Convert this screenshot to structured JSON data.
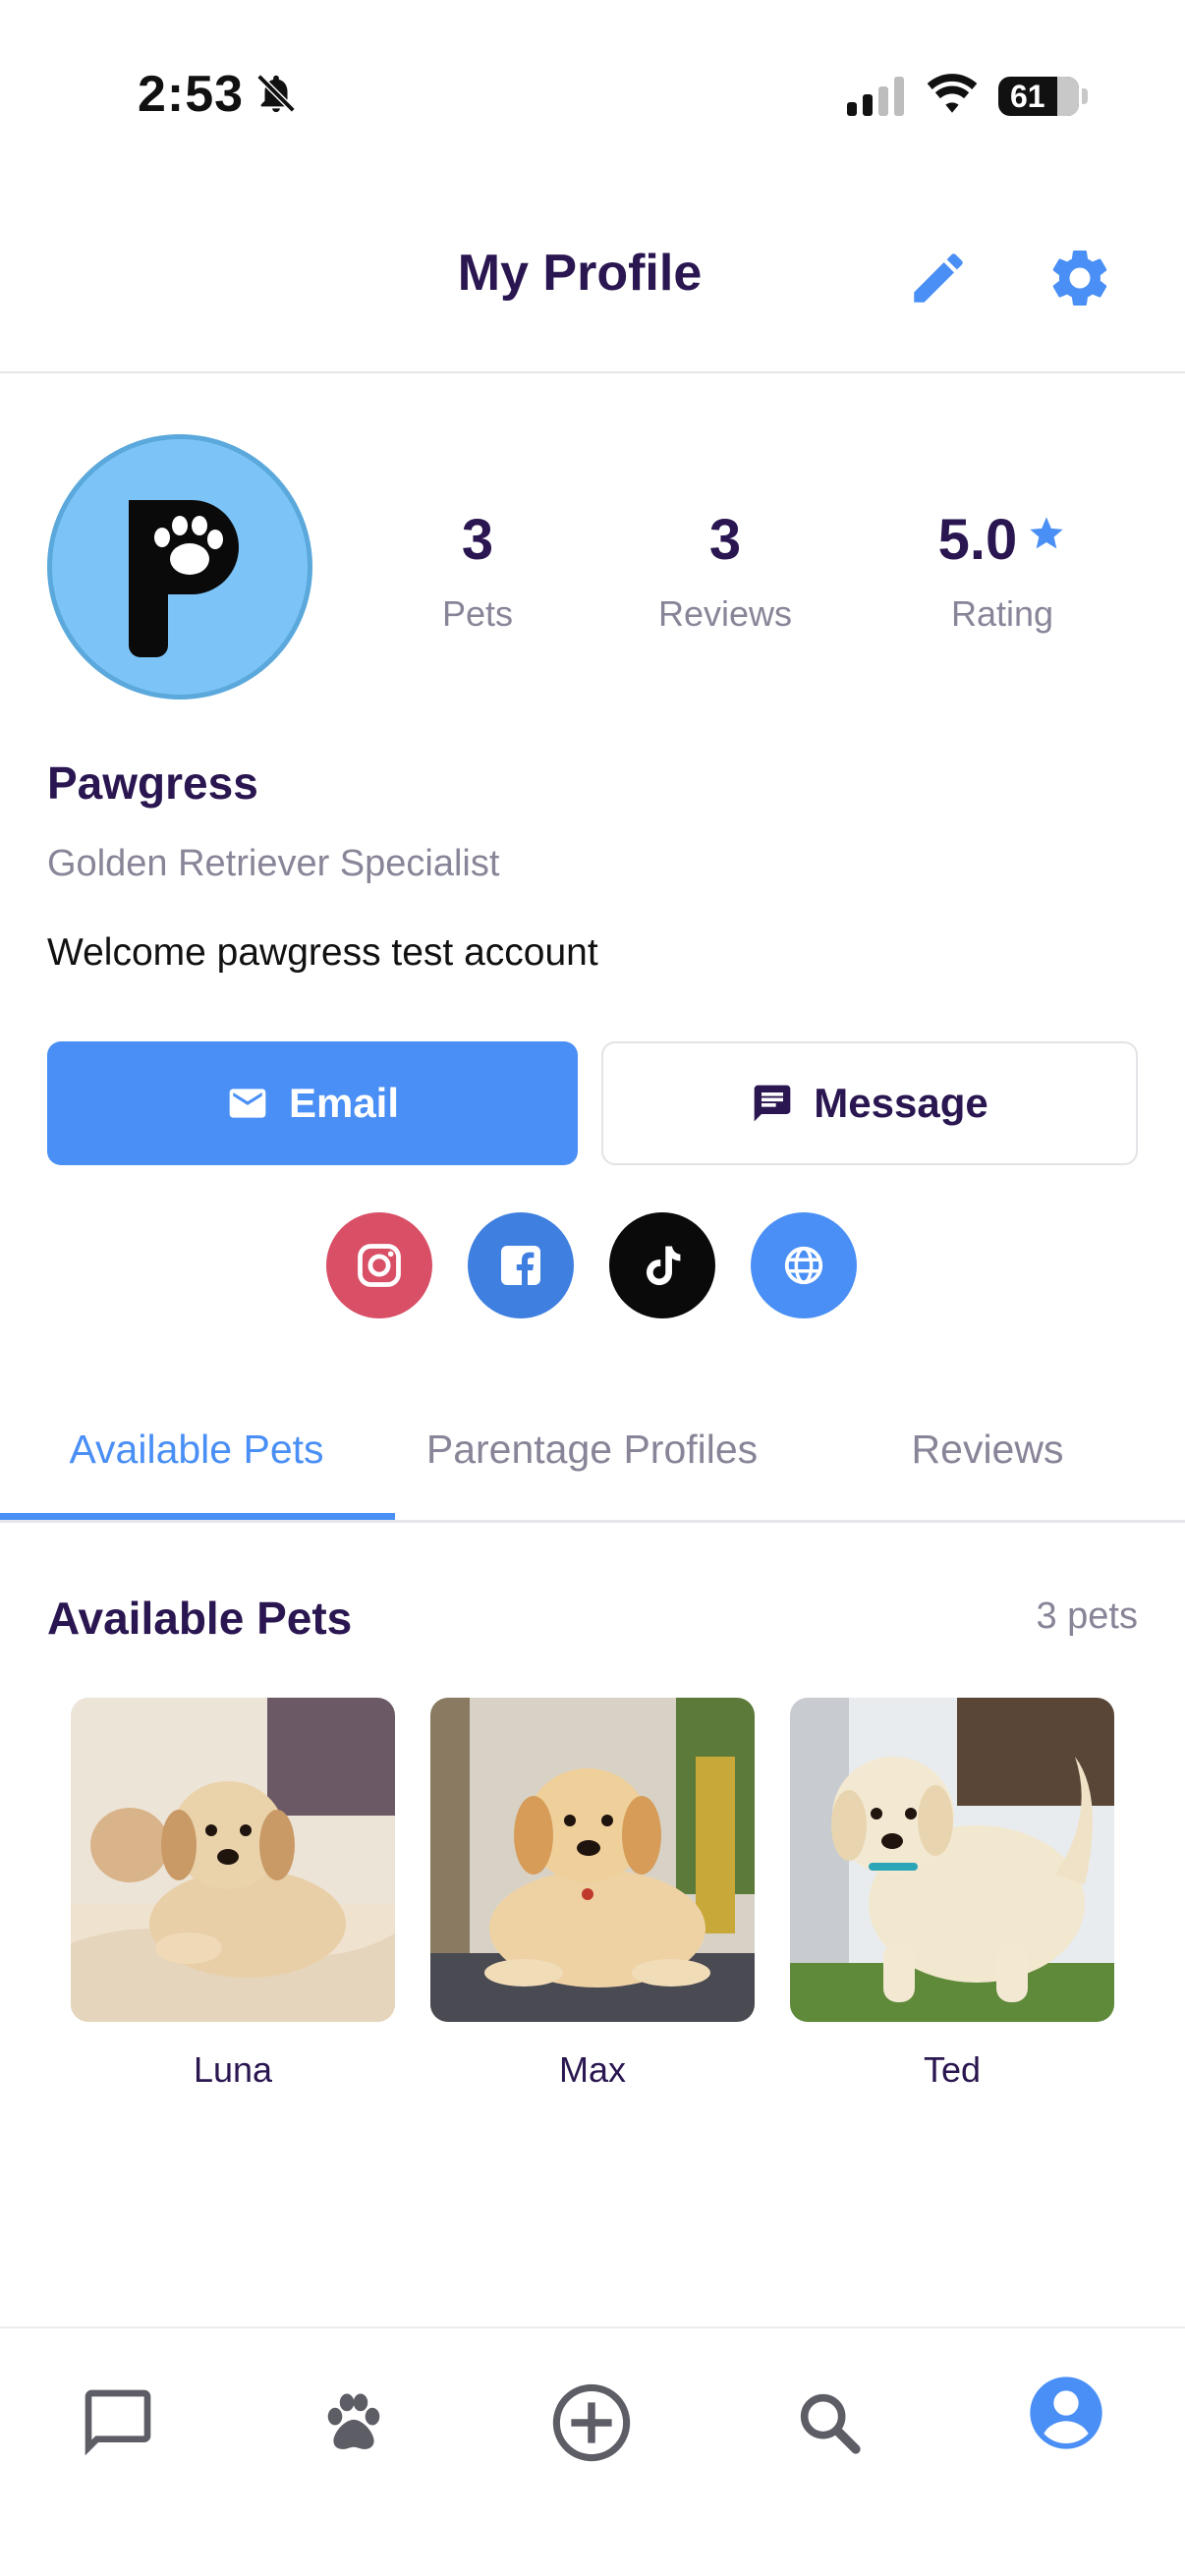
{
  "status_bar": {
    "time": "2:53",
    "battery": "61"
  },
  "header": {
    "title": "My Profile"
  },
  "profile": {
    "name": "Pawgress",
    "subtitle": "Golden Retriever Specialist",
    "bio": "Welcome pawgress test account",
    "stats": {
      "pets_value": "3",
      "pets_label": "Pets",
      "reviews_value": "3",
      "reviews_label": "Reviews",
      "rating_value": "5.0",
      "rating_label": "Rating"
    }
  },
  "actions": {
    "email_label": "Email",
    "message_label": "Message"
  },
  "social": [
    "instagram-icon",
    "facebook-icon",
    "tiktok-icon",
    "globe-icon"
  ],
  "tabs": [
    {
      "label": "Available Pets",
      "active": true
    },
    {
      "label": "Parentage Profiles",
      "active": false
    },
    {
      "label": "Reviews",
      "active": false
    }
  ],
  "section": {
    "title": "Available Pets",
    "count": "3 pets"
  },
  "pets": [
    {
      "name": "Luna"
    },
    {
      "name": "Max"
    },
    {
      "name": "Ted"
    }
  ],
  "bottom_nav": [
    "chat-icon",
    "paw-icon",
    "add-circle-icon",
    "search-icon",
    "profile-icon"
  ],
  "colors": {
    "accent": "#4a8ff5",
    "title": "#2a1650",
    "muted": "#8a8498",
    "avatar_bg": "#7cc4f8"
  }
}
